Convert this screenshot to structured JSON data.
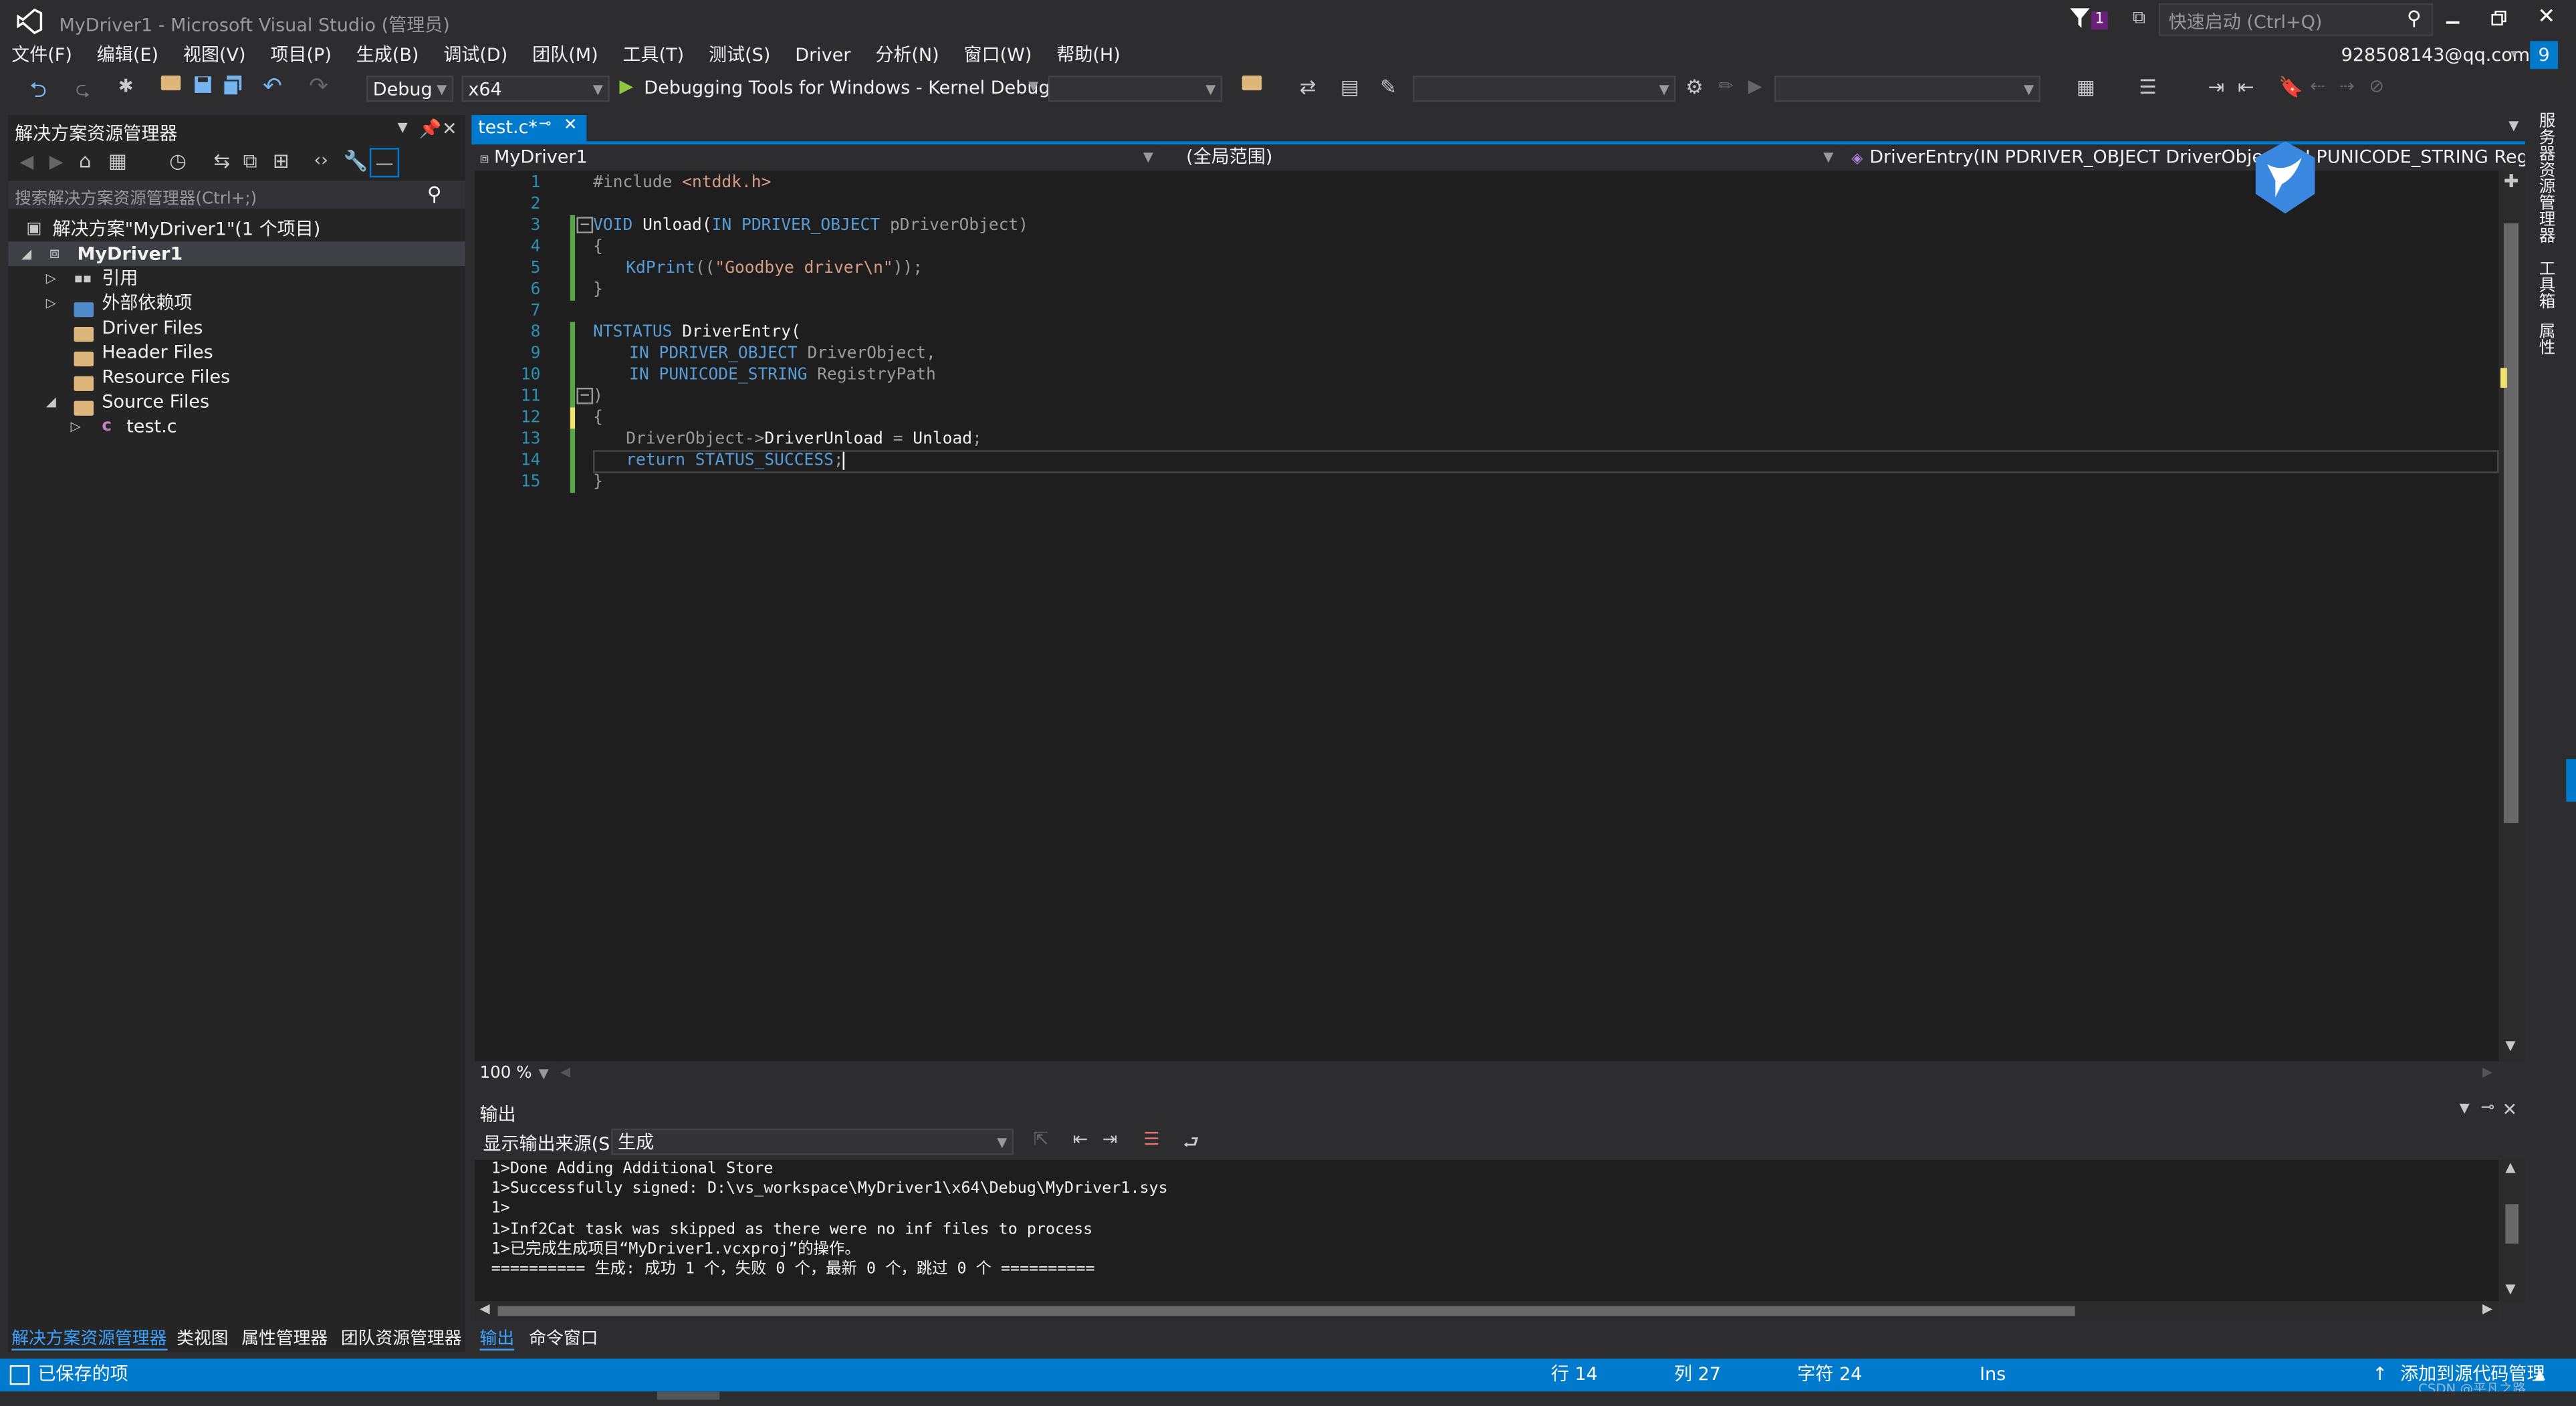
{
  "window": {
    "title": "MyDriver1 - Microsoft Visual Studio (管理员)",
    "notification_count": "1",
    "quick_launch_placeholder": "快速启动 (Ctrl+Q)",
    "account": "928508143@qq.com",
    "badge": "9"
  },
  "menu": [
    "文件(F)",
    "编辑(E)",
    "视图(V)",
    "项目(P)",
    "生成(B)",
    "调试(D)",
    "团队(M)",
    "工具(T)",
    "测试(S)",
    "Driver",
    "分析(N)",
    "窗口(W)",
    "帮助(H)"
  ],
  "toolbar": {
    "config": "Debug",
    "platform": "x64",
    "debugger": "Debugging Tools for Windows - Kernel Debugger"
  },
  "solution_explorer": {
    "title": "解决方案资源管理器",
    "search_placeholder": "搜索解决方案资源管理器(Ctrl+;)",
    "solution": "解决方案\"MyDriver1\"(1 个项目)",
    "project": "MyDriver1",
    "items": {
      "ref": "引用",
      "ext": "外部依赖项",
      "driver_files": "Driver Files",
      "header_files": "Header Files",
      "resource_files": "Resource Files",
      "source_files": "Source Files",
      "test_c": "test.c"
    }
  },
  "editor": {
    "tab": "test.c*",
    "nav_project": "MyDriver1",
    "nav_scope": "(全局范围)",
    "nav_member": "DriverEntry(IN PDRIVER_OBJECT DriverObject, IN PUNICODE_STRING RegistryPath",
    "zoom": "100 %",
    "line_numbers": [
      "1",
      "2",
      "3",
      "4",
      "5",
      "6",
      "7",
      "8",
      "9",
      "10",
      "11",
      "12",
      "13",
      "14",
      "15"
    ],
    "lines": {
      "l1a": "#include ",
      "l1b": "<ntddk.h>",
      "l3a": "VOID",
      "l3b": " Unload(",
      "l3c": "IN",
      "l3d": " PDRIVER_OBJECT",
      "l3e": " pDriverObject)",
      "l4": "{",
      "l5a": "KdPrint",
      "l5b": "((",
      "l5c": "\"Goodbye driver\\n\"",
      "l5d": "));",
      "l6": "}",
      "l8a": "NTSTATUS",
      "l8b": " DriverEntry(",
      "l9a": "IN",
      "l9b": " PDRIVER_OBJECT",
      "l9c": " DriverObject,",
      "l10a": "IN",
      "l10b": " PUNICODE_STRING",
      "l10c": " RegistryPath",
      "l11": ")",
      "l12": "{",
      "l13a": "DriverObject->",
      "l13b": "DriverUnload",
      "l13c": " = ",
      "l13d": "Unload",
      "l13e": ";",
      "l14a": "return",
      "l14b": " STATUS_SUCCESS",
      "l14c": ";",
      "l15": "}"
    }
  },
  "output": {
    "title": "输出",
    "source_label": "显示输出来源(S):",
    "source_value": "生成",
    "lines": [
      "1>Done Adding Additional Store",
      "1>Successfully signed: D:\\vs_workspace\\MyDriver1\\x64\\Debug\\MyDriver1.sys",
      "1>",
      "1>Inf2Cat task was skipped as there were no inf files to process",
      "1>已完成生成项目“MyDriver1.vcxproj”的操作。",
      "========== 生成: 成功 1 个，失败 0 个，最新 0 个，跳过 0 个 =========="
    ]
  },
  "bottom_tabs_left": [
    "解决方案资源管理器",
    "类视图",
    "属性管理器",
    "团队资源管理器"
  ],
  "bottom_tabs_right": [
    "输出",
    "命令窗口"
  ],
  "right_rail": [
    "服务器资源管理器",
    "工具箱",
    "属性"
  ],
  "status": {
    "saved": "已保存的项",
    "line": "行 14",
    "col": "列 27",
    "char": "字符 24",
    "mode": "Ins",
    "source_control": "添加到源代码管理",
    "watermark": "CSDN @平凡之路"
  },
  "colors": {
    "accent": "#007acc",
    "editor_bg": "#1e1e1e",
    "chrome_bg": "#2d2d30"
  }
}
